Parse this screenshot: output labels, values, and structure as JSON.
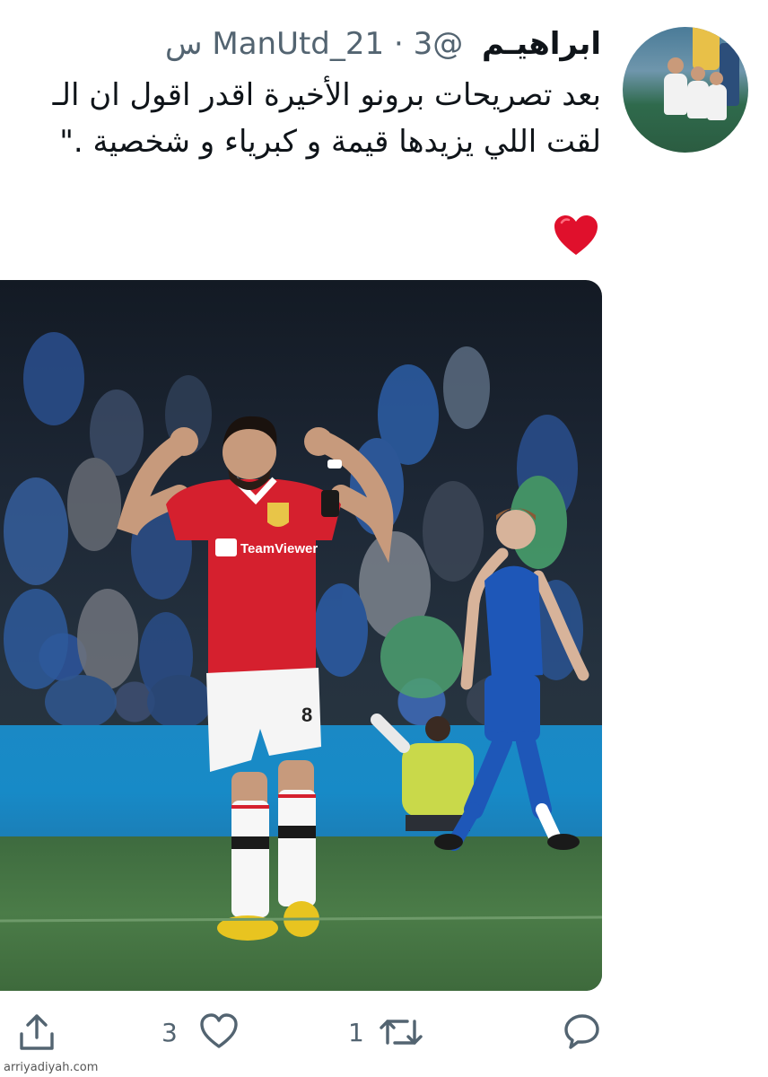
{
  "tweet": {
    "display_name": "ابراهيـم",
    "handle": "@ManUtd_21",
    "separator": "·",
    "time": "3 س",
    "text_line1": "بعد تصريحات برونو الأخيرة اقدر اقول ان الـ",
    "text_line2": "لقت اللي يزيدها قيمة و كبرياء و شخصية .\"",
    "emoji": "heart",
    "media": {
      "player_sponsor": "TeamViewer",
      "player_number": "8"
    }
  },
  "actions": {
    "share_icon": "share-icon",
    "like_icon": "heart-outline-icon",
    "like_count": "3",
    "retweet_icon": "retweet-icon",
    "retweet_count": "1",
    "reply_icon": "reply-icon"
  },
  "footer": {
    "credit": "arriyadiyah.com"
  },
  "colors": {
    "secondary_text": "#536471",
    "heart_emoji": "#e0102c",
    "united_red": "#d5202e",
    "leicester_blue": "#1e57b8"
  }
}
